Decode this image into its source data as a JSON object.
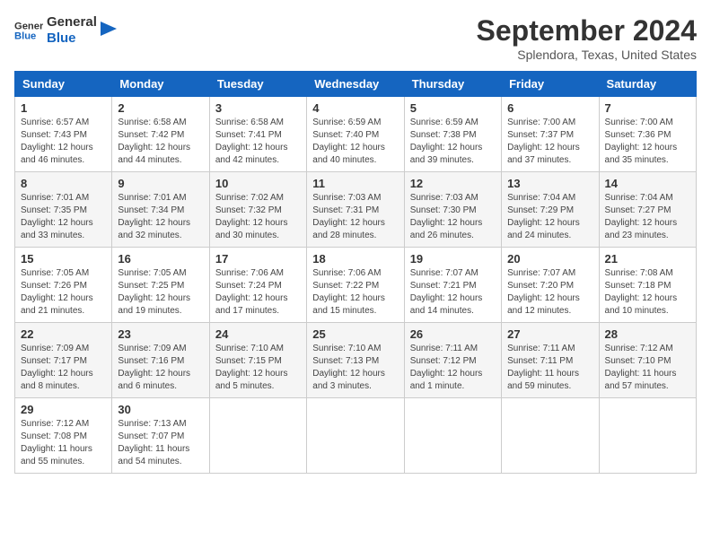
{
  "logo": {
    "text_general": "General",
    "text_blue": "Blue"
  },
  "title": "September 2024",
  "subtitle": "Splendora, Texas, United States",
  "days_of_week": [
    "Sunday",
    "Monday",
    "Tuesday",
    "Wednesday",
    "Thursday",
    "Friday",
    "Saturday"
  ],
  "weeks": [
    [
      {
        "day": "1",
        "sunrise": "6:57 AM",
        "sunset": "7:43 PM",
        "daylight": "12 hours and 46 minutes."
      },
      {
        "day": "2",
        "sunrise": "6:58 AM",
        "sunset": "7:42 PM",
        "daylight": "12 hours and 44 minutes."
      },
      {
        "day": "3",
        "sunrise": "6:58 AM",
        "sunset": "7:41 PM",
        "daylight": "12 hours and 42 minutes."
      },
      {
        "day": "4",
        "sunrise": "6:59 AM",
        "sunset": "7:40 PM",
        "daylight": "12 hours and 40 minutes."
      },
      {
        "day": "5",
        "sunrise": "6:59 AM",
        "sunset": "7:38 PM",
        "daylight": "12 hours and 39 minutes."
      },
      {
        "day": "6",
        "sunrise": "7:00 AM",
        "sunset": "7:37 PM",
        "daylight": "12 hours and 37 minutes."
      },
      {
        "day": "7",
        "sunrise": "7:00 AM",
        "sunset": "7:36 PM",
        "daylight": "12 hours and 35 minutes."
      }
    ],
    [
      {
        "day": "8",
        "sunrise": "7:01 AM",
        "sunset": "7:35 PM",
        "daylight": "12 hours and 33 minutes."
      },
      {
        "day": "9",
        "sunrise": "7:01 AM",
        "sunset": "7:34 PM",
        "daylight": "12 hours and 32 minutes."
      },
      {
        "day": "10",
        "sunrise": "7:02 AM",
        "sunset": "7:32 PM",
        "daylight": "12 hours and 30 minutes."
      },
      {
        "day": "11",
        "sunrise": "7:03 AM",
        "sunset": "7:31 PM",
        "daylight": "12 hours and 28 minutes."
      },
      {
        "day": "12",
        "sunrise": "7:03 AM",
        "sunset": "7:30 PM",
        "daylight": "12 hours and 26 minutes."
      },
      {
        "day": "13",
        "sunrise": "7:04 AM",
        "sunset": "7:29 PM",
        "daylight": "12 hours and 24 minutes."
      },
      {
        "day": "14",
        "sunrise": "7:04 AM",
        "sunset": "7:27 PM",
        "daylight": "12 hours and 23 minutes."
      }
    ],
    [
      {
        "day": "15",
        "sunrise": "7:05 AM",
        "sunset": "7:26 PM",
        "daylight": "12 hours and 21 minutes."
      },
      {
        "day": "16",
        "sunrise": "7:05 AM",
        "sunset": "7:25 PM",
        "daylight": "12 hours and 19 minutes."
      },
      {
        "day": "17",
        "sunrise": "7:06 AM",
        "sunset": "7:24 PM",
        "daylight": "12 hours and 17 minutes."
      },
      {
        "day": "18",
        "sunrise": "7:06 AM",
        "sunset": "7:22 PM",
        "daylight": "12 hours and 15 minutes."
      },
      {
        "day": "19",
        "sunrise": "7:07 AM",
        "sunset": "7:21 PM",
        "daylight": "12 hours and 14 minutes."
      },
      {
        "day": "20",
        "sunrise": "7:07 AM",
        "sunset": "7:20 PM",
        "daylight": "12 hours and 12 minutes."
      },
      {
        "day": "21",
        "sunrise": "7:08 AM",
        "sunset": "7:18 PM",
        "daylight": "12 hours and 10 minutes."
      }
    ],
    [
      {
        "day": "22",
        "sunrise": "7:09 AM",
        "sunset": "7:17 PM",
        "daylight": "12 hours and 8 minutes."
      },
      {
        "day": "23",
        "sunrise": "7:09 AM",
        "sunset": "7:16 PM",
        "daylight": "12 hours and 6 minutes."
      },
      {
        "day": "24",
        "sunrise": "7:10 AM",
        "sunset": "7:15 PM",
        "daylight": "12 hours and 5 minutes."
      },
      {
        "day": "25",
        "sunrise": "7:10 AM",
        "sunset": "7:13 PM",
        "daylight": "12 hours and 3 minutes."
      },
      {
        "day": "26",
        "sunrise": "7:11 AM",
        "sunset": "7:12 PM",
        "daylight": "12 hours and 1 minute."
      },
      {
        "day": "27",
        "sunrise": "7:11 AM",
        "sunset": "7:11 PM",
        "daylight": "11 hours and 59 minutes."
      },
      {
        "day": "28",
        "sunrise": "7:12 AM",
        "sunset": "7:10 PM",
        "daylight": "11 hours and 57 minutes."
      }
    ],
    [
      {
        "day": "29",
        "sunrise": "7:12 AM",
        "sunset": "7:08 PM",
        "daylight": "11 hours and 55 minutes."
      },
      {
        "day": "30",
        "sunrise": "7:13 AM",
        "sunset": "7:07 PM",
        "daylight": "11 hours and 54 minutes."
      },
      null,
      null,
      null,
      null,
      null
    ]
  ],
  "labels": {
    "sunrise": "Sunrise:",
    "sunset": "Sunset:",
    "daylight": "Daylight:"
  }
}
